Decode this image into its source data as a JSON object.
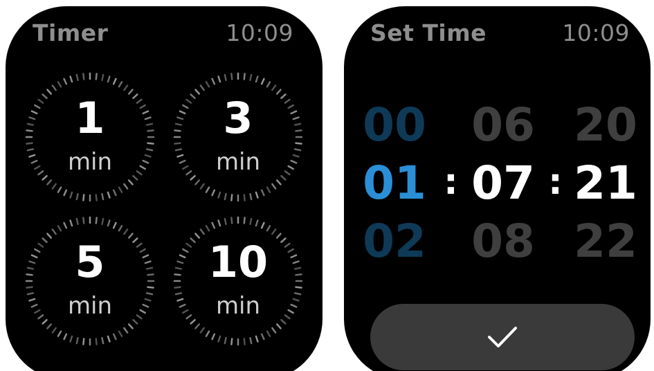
{
  "timer_screen": {
    "title": "Timer",
    "clock": "10:09",
    "presets": [
      {
        "value": "1",
        "unit": "min"
      },
      {
        "value": "3",
        "unit": "min"
      },
      {
        "value": "5",
        "unit": "min"
      },
      {
        "value": "10",
        "unit": "min"
      }
    ]
  },
  "set_time_screen": {
    "title": "Set Time",
    "clock": "10:09",
    "hours": {
      "prev": "00",
      "selected": "01",
      "next": "02"
    },
    "minutes": {
      "prev": "06",
      "selected": "07",
      "next": "08"
    },
    "seconds": {
      "prev": "20",
      "selected": "21",
      "next": "22"
    },
    "separator": ":",
    "confirm_icon": "checkmark-icon"
  },
  "colors": {
    "watch_background": "#000000",
    "header_text": "#8e8e8e",
    "hours_selected": "#2a8fd6",
    "hours_dim": "#0e3a57",
    "dim_digits": "#3f3f3f",
    "confirm_button": "#3a3a3a"
  }
}
